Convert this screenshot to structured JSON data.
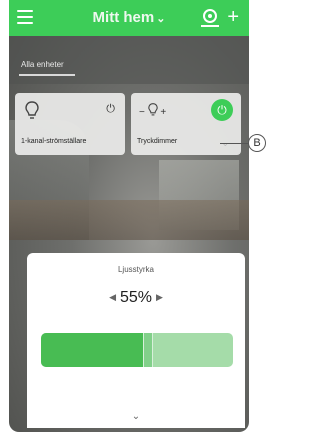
{
  "header": {
    "title": "Mitt hem",
    "title_chevron": "⌄",
    "menu_icon": "hamburger-icon",
    "add_icon": "plus-icon",
    "scan_icon": "eye-icon"
  },
  "tabs": {
    "active": "Alla enheter"
  },
  "devices": [
    {
      "name": "1-kanal-strömställare",
      "icon": "bulb-icon",
      "power_icon": "⏻"
    },
    {
      "name": "Tryckdimmer",
      "icon": "bulb-icon",
      "power_icon": "⏻",
      "dim_minus": "−",
      "dim_plus": "+",
      "chevron": "⌄"
    }
  ],
  "callout": {
    "label": "B"
  },
  "brightness_sheet": {
    "title": "Ljusstyrka",
    "level_text": "55%",
    "level_value": 55,
    "left_arrow": "◀",
    "right_arrow": "▶",
    "collapse_chevron": "⌄"
  },
  "colors": {
    "accent": "#3dcd58",
    "slider_fill": "#48bc53",
    "slider_track": "#a5dca9"
  }
}
